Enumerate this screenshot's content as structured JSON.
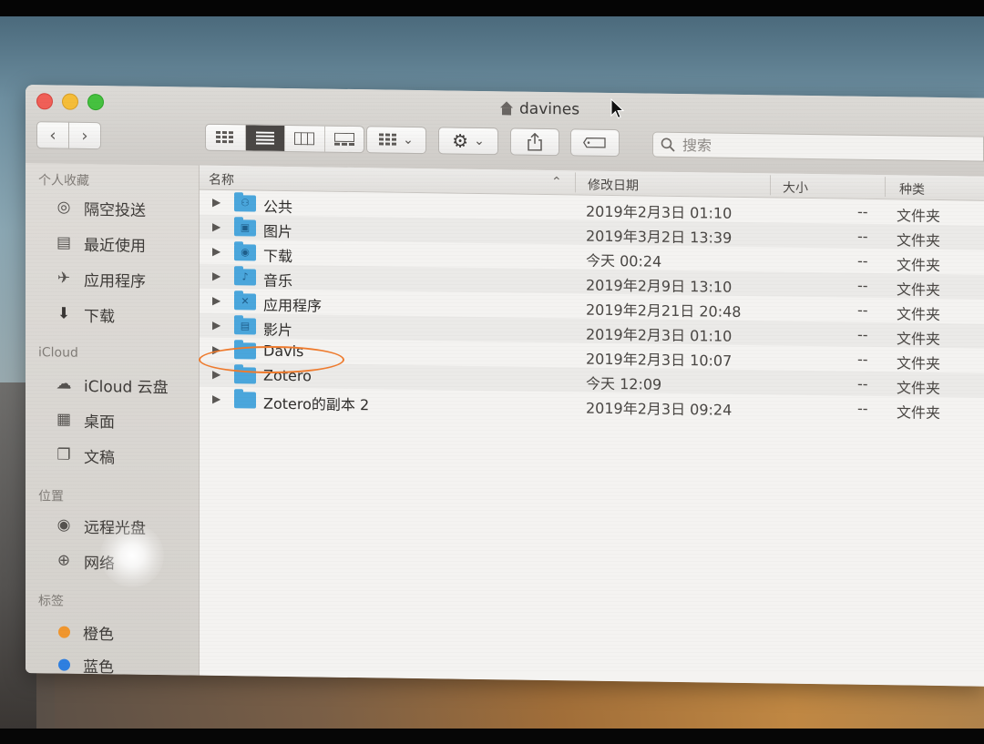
{
  "window": {
    "title": "davines",
    "title_icon": "home-icon"
  },
  "toolbar": {
    "back_glyph": "‹",
    "forward_glyph": "›",
    "search_placeholder": "搜索",
    "view_modes": [
      "icon-view",
      "list-view",
      "column-view",
      "gallery-view"
    ],
    "active_view": "list-view"
  },
  "sidebar": {
    "favorites_header": "个人收藏",
    "favorites": [
      {
        "label": "隔空投送",
        "icon": "airdrop-icon"
      },
      {
        "label": "最近使用",
        "icon": "recents-icon"
      },
      {
        "label": "应用程序",
        "icon": "applications-icon"
      },
      {
        "label": "下载",
        "icon": "downloads-icon"
      }
    ],
    "icloud_header": "iCloud",
    "icloud": [
      {
        "label": "iCloud 云盘",
        "icon": "cloud-icon"
      },
      {
        "label": "桌面",
        "icon": "desktop-icon"
      },
      {
        "label": "文稿",
        "icon": "documents-icon"
      }
    ],
    "locations_header": "位置",
    "locations": [
      {
        "label": "远程光盘",
        "icon": "disc-icon"
      },
      {
        "label": "网络",
        "icon": "network-icon"
      }
    ],
    "tags_header": "标签",
    "tags": [
      {
        "label": "橙色",
        "color": "#f0962e"
      },
      {
        "label": "蓝色",
        "color": "#2f7fe0"
      }
    ]
  },
  "columns": {
    "name": "名称",
    "modified": "修改日期",
    "size": "大小",
    "kind": "种类"
  },
  "files": [
    {
      "name": "公共",
      "modified": "2019年2月3日 01:10",
      "size": "--",
      "kind": "文件夹",
      "glyph": "⚇"
    },
    {
      "name": "图片",
      "modified": "2019年3月2日 13:39",
      "size": "--",
      "kind": "文件夹",
      "glyph": "▣"
    },
    {
      "name": "下载",
      "modified": "今天 00:24",
      "size": "--",
      "kind": "文件夹",
      "glyph": "◉"
    },
    {
      "name": "音乐",
      "modified": "2019年2月9日 13:10",
      "size": "--",
      "kind": "文件夹",
      "glyph": "♪"
    },
    {
      "name": "应用程序",
      "modified": "2019年2月21日 20:48",
      "size": "--",
      "kind": "文件夹",
      "glyph": "✕"
    },
    {
      "name": "影片",
      "modified": "2019年2月3日 01:10",
      "size": "--",
      "kind": "文件夹",
      "glyph": "▤"
    },
    {
      "name": "Davis",
      "modified": "2019年2月3日 10:07",
      "size": "--",
      "kind": "文件夹",
      "glyph": ""
    },
    {
      "name": "Zotero",
      "modified": "今天 12:09",
      "size": "--",
      "kind": "文件夹",
      "glyph": ""
    },
    {
      "name": "Zotero的副本 2",
      "modified": "2019年2月3日 09:24",
      "size": "--",
      "kind": "文件夹",
      "glyph": ""
    }
  ]
}
